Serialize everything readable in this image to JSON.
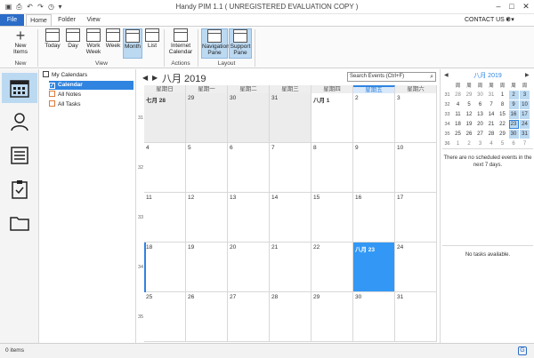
{
  "window": {
    "title": "Handy PIM 1.1 ( UNREGISTERED EVALUATION COPY )",
    "minimize": "–",
    "maximize": "□",
    "close": "✕"
  },
  "tabs": {
    "file": "File",
    "home": "Home",
    "folder": "Folder",
    "view": "View",
    "contact_us": "CONTACT US ▾",
    "gear": "⚙▾"
  },
  "ribbon": {
    "new_items": "New Items",
    "group_new": "New",
    "today": "Today",
    "day": "Day",
    "work_week": "Work Week",
    "week": "Week",
    "month": "Month",
    "list": "List",
    "group_view": "View",
    "internet_calendar": "Internet Calendar",
    "group_actions": "Actions",
    "navigation_pane": "Navigation Pane",
    "support_pane": "Support Pane",
    "group_layout": "Layout"
  },
  "tree": {
    "root": "My Calendars",
    "calendar": "Calendar",
    "all_notes": "All Notes",
    "all_tasks": "All Tasks"
  },
  "month": {
    "title": "八月 2019",
    "search_placeholder": "Search Events (Ctrl+F)",
    "day_headers": [
      "星期日",
      "星期一",
      "星期二",
      "星期三",
      "星期四",
      "星期五",
      "星期六"
    ],
    "today_col": 5,
    "weeks": [
      {
        "wk": "31",
        "days": [
          "七月 28",
          "29",
          "30",
          "31",
          "八月 1",
          "2",
          "3"
        ]
      },
      {
        "wk": "32",
        "days": [
          "4",
          "5",
          "6",
          "7",
          "8",
          "9",
          "10"
        ]
      },
      {
        "wk": "33",
        "days": [
          "11",
          "12",
          "13",
          "14",
          "15",
          "16",
          "17"
        ]
      },
      {
        "wk": "34",
        "days": [
          "18",
          "19",
          "20",
          "21",
          "22",
          "八月 23",
          "24"
        ]
      },
      {
        "wk": "35",
        "days": [
          "25",
          "26",
          "27",
          "28",
          "29",
          "30",
          "31"
        ]
      }
    ]
  },
  "mini": {
    "title": "八月 2019",
    "prev": "◀",
    "next": "▶",
    "day_headers": [
      "周",
      "周",
      "周",
      "周",
      "周",
      "周",
      "周"
    ],
    "weeks": [
      {
        "wk": "31",
        "days": [
          "28",
          "29",
          "30",
          "31",
          "1",
          "2",
          "3"
        ]
      },
      {
        "wk": "32",
        "days": [
          "4",
          "5",
          "6",
          "7",
          "8",
          "9",
          "10"
        ]
      },
      {
        "wk": "33",
        "days": [
          "11",
          "12",
          "13",
          "14",
          "15",
          "16",
          "17"
        ]
      },
      {
        "wk": "34",
        "days": [
          "18",
          "19",
          "20",
          "21",
          "22",
          "23",
          "24"
        ]
      },
      {
        "wk": "35",
        "days": [
          "25",
          "26",
          "27",
          "28",
          "29",
          "30",
          "31"
        ]
      },
      {
        "wk": "36",
        "days": [
          "1",
          "2",
          "3",
          "4",
          "5",
          "6",
          "7"
        ]
      }
    ],
    "events_msg": "There are no scheduled events in the next 7 days.",
    "tasks_msg": "No tasks available."
  },
  "status": {
    "items": "0 items"
  },
  "colors": {
    "accent": "#2f84e0",
    "file_tab": "#2a6cc7",
    "selected": "#bcd9f2",
    "today_cell": "#3398f5"
  }
}
